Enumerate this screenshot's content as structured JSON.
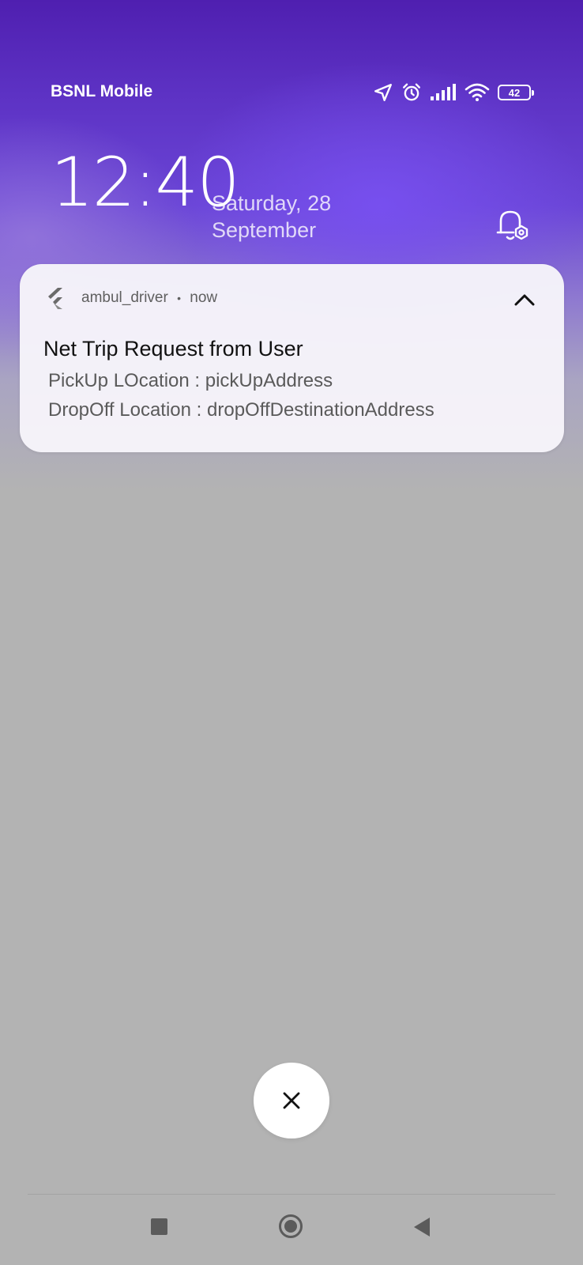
{
  "status_bar": {
    "carrier": "BSNL Mobile",
    "battery_level": "42",
    "icons": [
      "location-icon",
      "alarm-icon",
      "signal-icon",
      "wifi-icon",
      "battery-icon"
    ]
  },
  "lockscreen": {
    "time": "12:40",
    "date_line1": "Saturday, 28",
    "date_line2": "September"
  },
  "notification": {
    "app_name": "ambul_driver",
    "separator": "•",
    "timestamp": "now",
    "title": "Net Trip Request from User",
    "line1": "PickUp LOcation : pickUpAddress",
    "line2": "DropOff Location : dropOffDestinationAddress"
  },
  "colors": {
    "accent_purple": "#6a45d6",
    "background_gray": "#b3b3b3",
    "card": "#f6f4fa"
  }
}
